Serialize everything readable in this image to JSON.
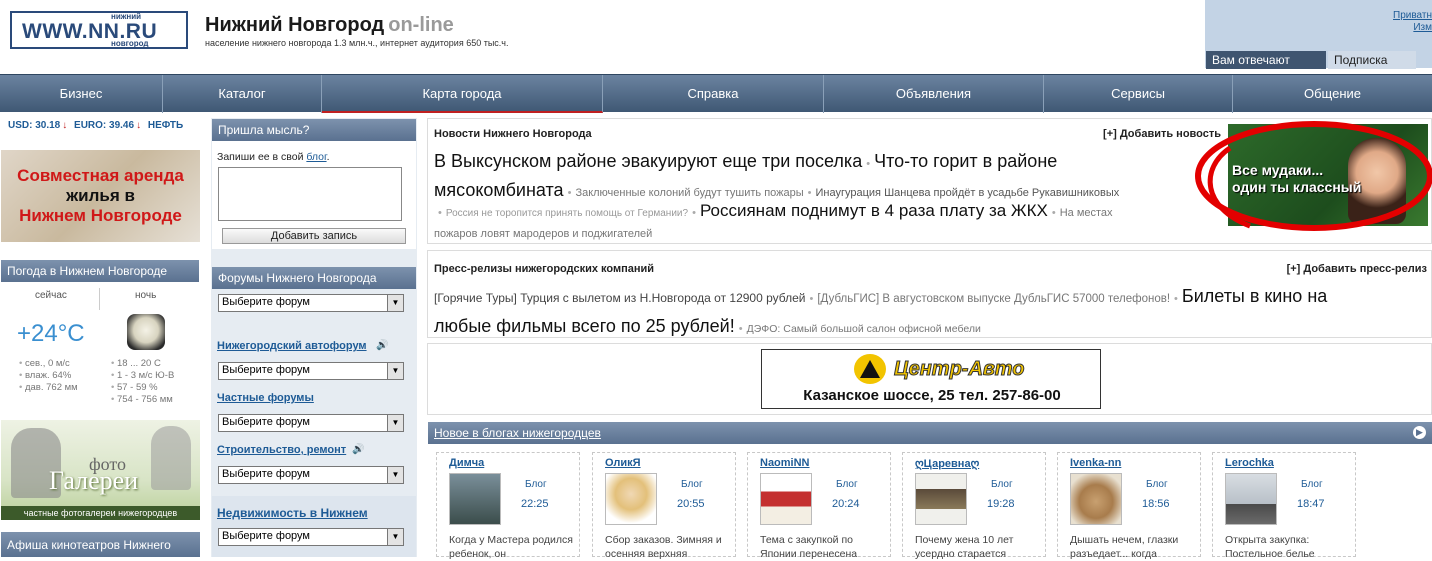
{
  "header": {
    "logo_text": "WWW.NN.RU",
    "logo_top": "нижний",
    "logo_bottom": "новгород",
    "title": "Нижний Новгород",
    "title_suffix": "on-line",
    "subtitle": "население нижнего новгорода 1.3 млн.ч., интернет аудитория 650 тыс.ч.",
    "right_link1": "Приватн",
    "right_link2": "Изм",
    "tab1": "Вам отвечают",
    "tab2": "Подписка"
  },
  "nav": [
    "Бизнес",
    "Каталог",
    "Карта города",
    "Справка",
    "Объявления",
    "Сервисы",
    "Общение"
  ],
  "currency": {
    "usd": "USD: 30.18",
    "euro": "EURO: 39.46",
    "oil": "НЕФТЬ",
    "arrow": "↓"
  },
  "banner_arenda": {
    "line1": "Совместная аренда",
    "line2": "жилья в",
    "line3": "Нижнем Новгороде"
  },
  "weather": {
    "title": "Погода в Нижнем Новгороде",
    "now_label": "сейчас",
    "night_label": "ночь",
    "temp": "+24°C",
    "now_details": [
      "сев., 0 м/с",
      "влаж. 64%",
      "дав. 762 мм"
    ],
    "night_details": [
      "18 ... 20 C",
      "1 - 3 м/с Ю-В",
      "57 - 59 %",
      "754 - 756 мм"
    ]
  },
  "banner_foto": {
    "line1": "фото",
    "line2": "Галереи",
    "caption": "частные фотогалереи нижегородцев"
  },
  "afisha": "Афиша кинотеатров Нижнего",
  "thought": {
    "title": "Пришла мысль?",
    "prompt": "Запиши ее в свой",
    "link": "блог",
    "after": ".",
    "button": "Добавить запись"
  },
  "forums": {
    "title": "Форумы Нижнего Новгорода",
    "select": "Выберите форум",
    "links": [
      "Нижегородский автофорум",
      "Частные форумы",
      "Строительство, ремонт",
      "Недвижимость в Нижнем"
    ]
  },
  "news": {
    "title": "Новости Нижнего Новгорода",
    "add": "[+] Добавить новость",
    "big1": "В Выксунском районе эвакуируют еще три поселка",
    "big2": "Что-то горит в районе",
    "big3": "мясокомбината",
    "small1": "Заключенные колоний будут тушить пожары",
    "small2": "Инаугурация Шанцева пройдёт в усадьбе Рукавишниковых",
    "small3": "Россия не торопится принять помощь от Германии?",
    "big4": "Россиянам поднимут в 4 раза плату за ЖКХ",
    "small4a": "На местах",
    "small4b": "пожаров ловят мародеров и поджигателей"
  },
  "ad_girl": {
    "line1": "Все мудаки...",
    "line2": "один ты классный"
  },
  "press": {
    "title": "Пресс-релизы нижегородских компаний",
    "add": "[+] Добавить пресс-релиз",
    "item1": "[Горячие Туры] Турция с вылетом из Н.Новгорода от 12900 рублей",
    "item2": "[ДубльГИС] В августовском выпуске ДубльГИС 57000 телефонов!",
    "big1": "Билеты в кино на",
    "big2": "любые фильмы всего по 25 рублей!",
    "item3": "ДЭФО: Самый большой салон офисной мебели"
  },
  "ad_auto": {
    "brand": "Центр-Авто",
    "address": "Казанское шоссе, 25 тел. 257-86-00"
  },
  "blogs": {
    "title": "Новое в блогах нижегородцев",
    "cards": [
      {
        "name": "Димча",
        "type": "Блог",
        "time": "22:25",
        "text": "Когда у Мастера родился ребенок, он"
      },
      {
        "name": "ОликЯ",
        "type": "Блог",
        "time": "20:55",
        "text": "Сбор заказов. Зимняя и осенняя верхняя"
      },
      {
        "name": "NaomiNN",
        "type": "Блог",
        "time": "20:24",
        "text": "Тема с закупкой по Японии перенесена"
      },
      {
        "name": "ღЦаревнаღ",
        "type": "Блог",
        "time": "19:28",
        "text": "Почему жена 10 лет усердно старается"
      },
      {
        "name": "Ivenka-nn",
        "type": "Блог",
        "time": "18:56",
        "text": "Дышать нечем, глазки разъедает... когда"
      },
      {
        "name": "Lerochka",
        "type": "Блог",
        "time": "18:47",
        "text": "Открыта закупка: Постельное белье"
      }
    ]
  },
  "colors": {
    "nav": "#4f6886",
    "accent_red": "#c02020",
    "link": "#1e5b96"
  }
}
